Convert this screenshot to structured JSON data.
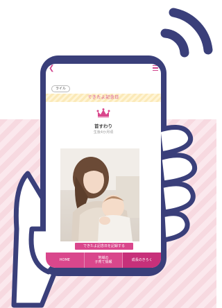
{
  "screen": {
    "badge_label": "ライル",
    "banner_title": "できたよ記念日",
    "milestone": {
      "title": "首すわり",
      "age": "生後4か月頃"
    },
    "record_button_label": "できたよ記念日を記録する",
    "nav": {
      "home_label": "HOME",
      "info_label": "地域の\n子育て情報",
      "growth_label": "成長のきろく"
    }
  },
  "colors": {
    "brand_pink": "#d9478c",
    "frame_navy": "#3a3f7a",
    "stripe_pink": "#f7d9e0",
    "banner_yellow": "#fbe9b8"
  },
  "icons": [
    "back-chevron-icon",
    "menu-icon",
    "crown-icon",
    "wifi-signal-icon"
  ]
}
